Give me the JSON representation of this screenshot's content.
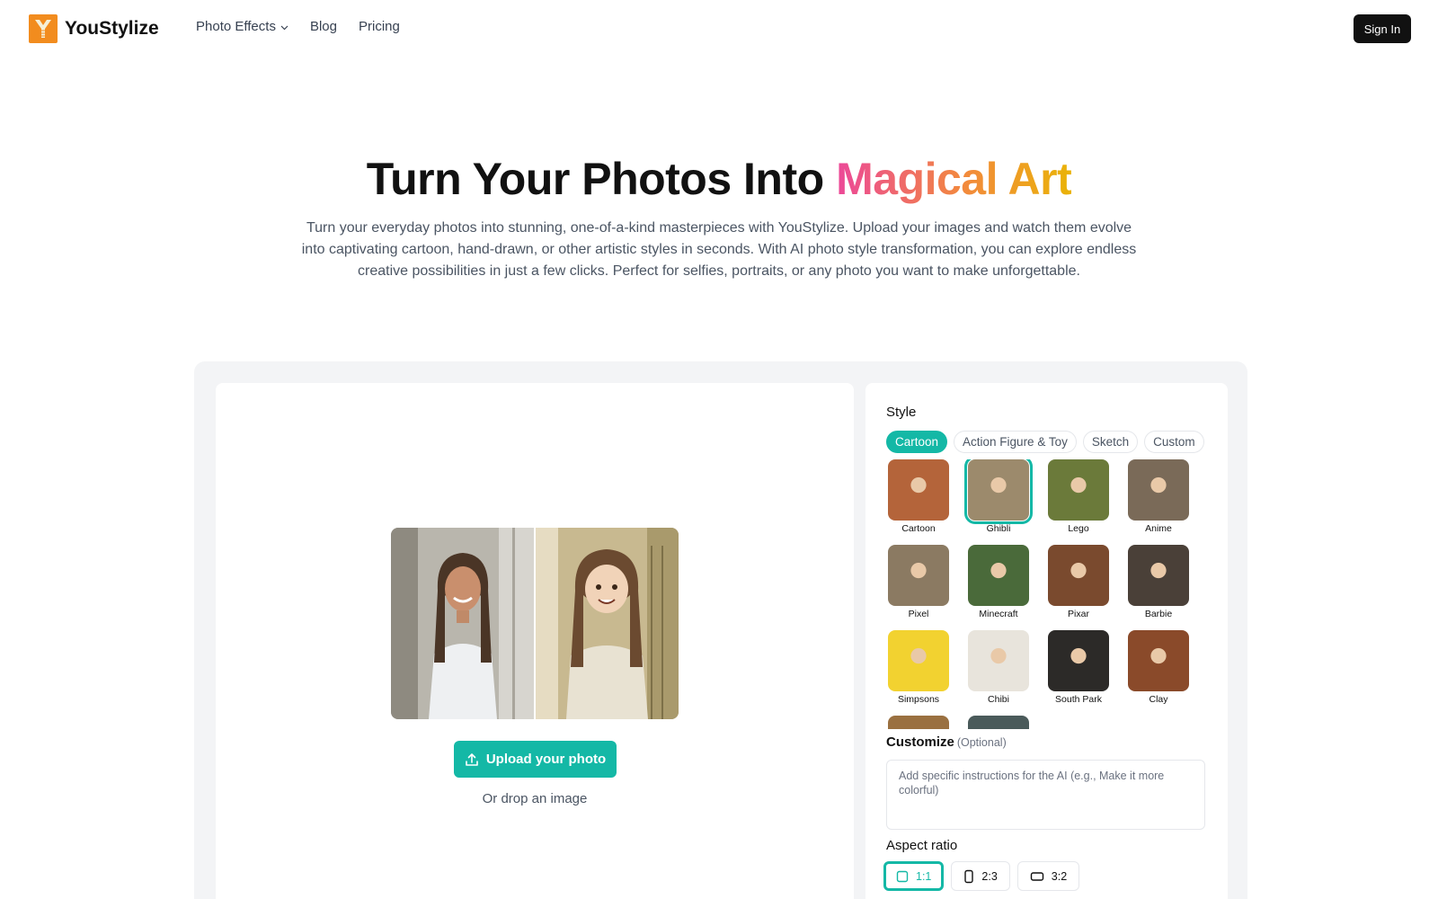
{
  "brand": {
    "name": "YouStylize"
  },
  "nav": {
    "links": [
      {
        "label": "Photo Effects",
        "has_dropdown": true
      },
      {
        "label": "Blog"
      },
      {
        "label": "Pricing"
      }
    ],
    "sign_in": "Sign In"
  },
  "hero": {
    "title_main": "Turn Your Photos Into ",
    "title_accent": "Magical Art",
    "subtitle": "Turn your everyday photos into stunning, one-of-a-kind masterpieces with YouStylize. Upload your images and watch them evolve into captivating cartoon, hand-drawn, or other artistic styles in seconds. With AI photo style transformation, you can explore endless creative possibilities in just a few clicks. Perfect for selfies, portraits, or any photo you want to make unforgettable."
  },
  "uploader": {
    "button_label": "Upload your photo",
    "drop_hint": "Or drop an image"
  },
  "style_panel": {
    "label": "Style",
    "tabs": [
      {
        "label": "Cartoon",
        "active": true
      },
      {
        "label": "Action Figure & Toy"
      },
      {
        "label": "Sketch"
      },
      {
        "label": "Custom"
      }
    ],
    "styles": [
      {
        "label": "Cartoon",
        "color": "#b4643a"
      },
      {
        "label": "Ghibli",
        "color": "#9c8a6c",
        "selected": true
      },
      {
        "label": "Lego",
        "color": "#6b7a3a"
      },
      {
        "label": "Anime",
        "color": "#7a6a58"
      },
      {
        "label": "Pixel",
        "color": "#8b7a62"
      },
      {
        "label": "Minecraft",
        "color": "#4a6a3a"
      },
      {
        "label": "Pixar",
        "color": "#7a4a2e"
      },
      {
        "label": "Barbie",
        "color": "#4a4038"
      },
      {
        "label": "Simpsons",
        "color": "#f2d230"
      },
      {
        "label": "Chibi",
        "color": "#e8e4dc"
      },
      {
        "label": "South Park",
        "color": "#2c2a28"
      },
      {
        "label": "Clay",
        "color": "#8a4a2a"
      },
      {
        "label": "",
        "color": "#9a7040"
      },
      {
        "label": "",
        "color": "#4a5a5a"
      }
    ]
  },
  "customize": {
    "label": "Customize",
    "optional": "(Optional)",
    "placeholder": "Add specific instructions for the AI (e.g., Make it more colorful)"
  },
  "aspect": {
    "label": "Aspect ratio",
    "options": [
      {
        "label": "1:1",
        "active": true,
        "icon": "square-icon"
      },
      {
        "label": "2:3",
        "icon": "portrait-icon"
      },
      {
        "label": "3:2",
        "icon": "landscape-icon"
      }
    ]
  },
  "colors": {
    "accent": "#14b8a6",
    "brand": "#f28c1e"
  }
}
